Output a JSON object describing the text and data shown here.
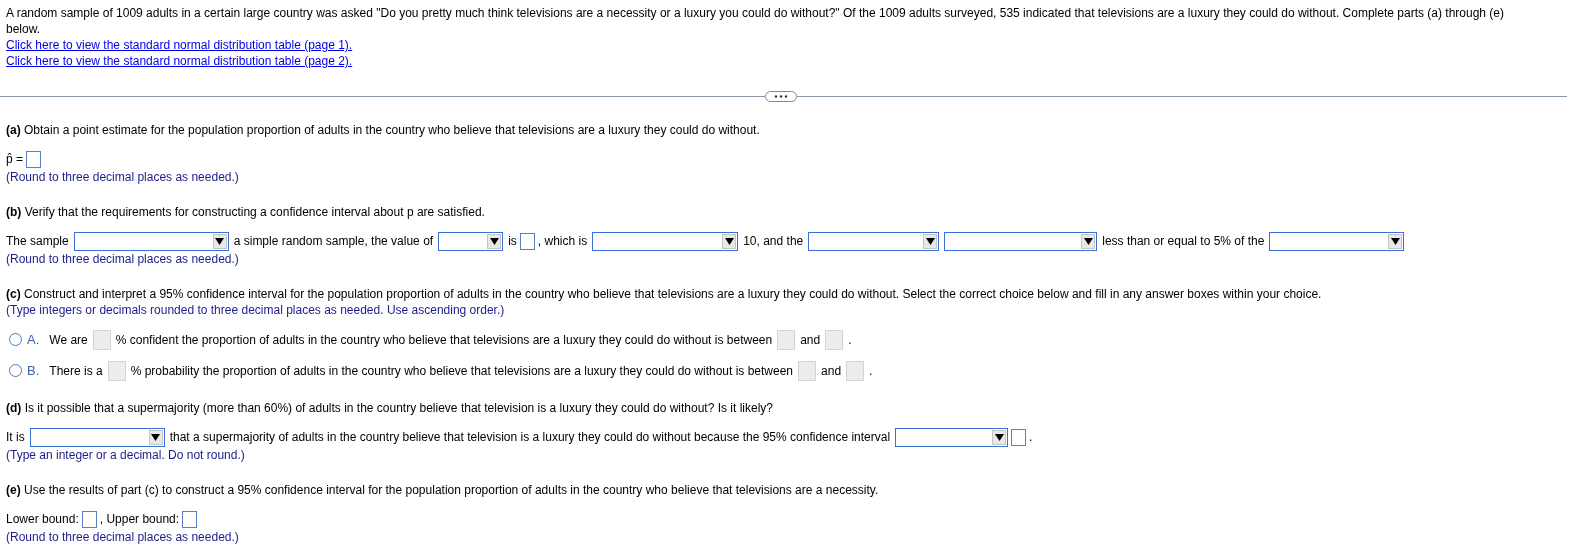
{
  "intro": "A random sample of 1009 adults in a certain large country was asked \"Do you pretty much think televisions are a necessity or a luxury you could do without?\" Of the 1009 adults surveyed, 535 indicated that televisions are a luxury they could do without. Complete parts (a) through (e) below.",
  "links": [
    "Click here to view the standard normal distribution table (page 1).",
    "Click here to view the standard normal distribution table (page 2)."
  ],
  "parts": [
    {
      "question": "**(a)** Obtain a point estimate for the population proportion of adults in the country who believe that televisions are a luxury they could do without.",
      "blocks": [
        {
          "kind": "line",
          "segments": [
            {
              "kind": "text",
              "text": "p̂ ="
            },
            {
              "kind": "box"
            }
          ]
        },
        {
          "kind": "hint",
          "text": "(Round to three decimal places as needed.)"
        }
      ]
    },
    {
      "question": "**(b)** Verify that the requirements for constructing a confidence interval about p are satisfied.",
      "blocks": [
        {
          "kind": "line",
          "segments": [
            {
              "kind": "text",
              "text": "The sample"
            },
            {
              "kind": "dropdown"
            },
            {
              "kind": "text",
              "text": "a simple random sample, the value of"
            },
            {
              "kind": "dropdown"
            },
            {
              "kind": "text",
              "text": "is"
            },
            {
              "kind": "box"
            },
            {
              "kind": "text",
              "text": ", which is"
            },
            {
              "kind": "dropdown"
            },
            {
              "kind": "text",
              "text": "10, and the"
            },
            {
              "kind": "dropdown"
            },
            {
              "kind": "dropdown"
            },
            {
              "kind": "text",
              "text": "less than or equal to 5% of the"
            },
            {
              "kind": "dropdown"
            }
          ]
        },
        {
          "kind": "hint",
          "text": "(Round to three decimal places as needed.)"
        }
      ]
    },
    {
      "question": "**(c)** Construct and interpret a 95% confidence interval for the population proportion of adults in the country who believe that televisions are a luxury they could do without. Select the correct choice below and fill in any answer boxes within your choice.",
      "blocks": [
        {
          "kind": "hint",
          "text": "(Type integers or decimals rounded to three decimal places as needed. Use ascending order.)"
        },
        {
          "kind": "choices",
          "choices": [
            {
              "letter": "A.",
              "selected": false,
              "segments": [
                {
                  "kind": "text",
                  "text": "We are"
                },
                {
                  "kind": "shaded_box"
                },
                {
                  "kind": "text",
                  "text": "% confident the proportion of adults in the country who believe that televisions are a luxury they could do without is between"
                },
                {
                  "kind": "shaded_box"
                },
                {
                  "kind": "text",
                  "text": "and"
                },
                {
                  "kind": "shaded_box"
                },
                {
                  "kind": "text",
                  "text": "."
                }
              ]
            },
            {
              "letter": "B.",
              "selected": false,
              "segments": [
                {
                  "kind": "text",
                  "text": "There is a"
                },
                {
                  "kind": "shaded_box"
                },
                {
                  "kind": "text",
                  "text": "% probability the proportion of adults in the country who believe that televisions are a luxury they could do without is between"
                },
                {
                  "kind": "shaded_box"
                },
                {
                  "kind": "text",
                  "text": "and"
                },
                {
                  "kind": "shaded_box"
                },
                {
                  "kind": "text",
                  "text": "."
                }
              ]
            }
          ]
        }
      ]
    },
    {
      "question": "**(d)** Is it possible that a supermajority (more than 60%) of adults in the country believe that television is a luxury they could do without? Is it likely?",
      "blocks": [
        {
          "kind": "line",
          "segments": [
            {
              "kind": "text",
              "text": "It is"
            },
            {
              "kind": "dropdown"
            },
            {
              "kind": "text",
              "text": "that a supermajority of adults in the country believe that television is a luxury they could do without because the 95% confidence interval"
            },
            {
              "kind": "dropdown"
            },
            {
              "kind": "box"
            },
            {
              "kind": "text",
              "text": "."
            }
          ]
        },
        {
          "kind": "hint",
          "text": "(Type an integer or a decimal. Do not round.)"
        }
      ]
    },
    {
      "question": "**(e)** Use the results of part (c) to construct a 95% confidence interval for the population proportion of adults in the country who believe that televisions are a necessity.",
      "blocks": [
        {
          "kind": "line",
          "segments": [
            {
              "kind": "text",
              "text": "Lower bound:"
            },
            {
              "kind": "box"
            },
            {
              "kind": "text",
              "text": ", Upper bound:"
            },
            {
              "kind": "box"
            }
          ]
        },
        {
          "kind": "hint",
          "text": "(Round to three decimal places as needed.)"
        }
      ]
    }
  ]
}
